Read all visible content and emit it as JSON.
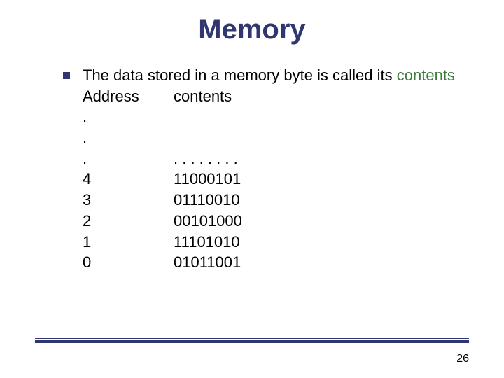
{
  "title": "Memory",
  "intro_part1": "The data stored in a memory byte is called its ",
  "intro_accent": "contents",
  "header_addr": "Address",
  "header_cont": "contents",
  "rows": [
    {
      "addr": ".",
      "cont": ""
    },
    {
      "addr": ".",
      "cont": ""
    },
    {
      "addr": ".",
      "cont": ". . . . . . . ."
    },
    {
      "addr": "4",
      "cont": "11000101"
    },
    {
      "addr": "3",
      "cont": "01110010"
    },
    {
      "addr": "2",
      "cont": "00101000"
    },
    {
      "addr": "1",
      "cont": "11101010"
    },
    {
      "addr": "0",
      "cont": "01011001"
    }
  ],
  "page_number": "26"
}
